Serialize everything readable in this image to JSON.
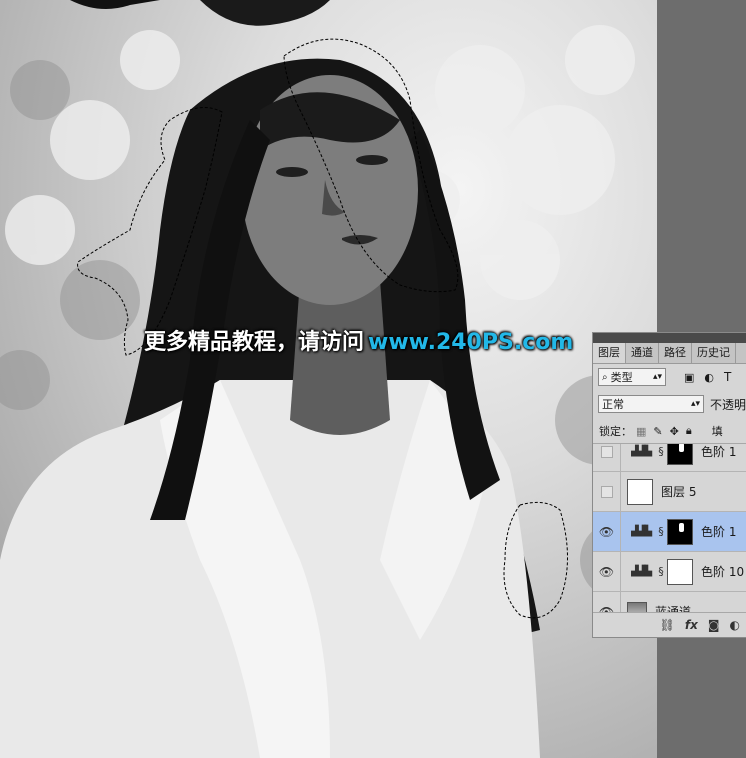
{
  "watermark": {
    "text_cn": "更多精品教程，请访问",
    "url": "www.240PS.com"
  },
  "panel": {
    "tabs": [
      "图层",
      "通道",
      "路径",
      "历史记"
    ],
    "filter": {
      "label": "类型",
      "icons": [
        "image-icon",
        "adjustment-icon",
        "text-icon"
      ],
      "text_icon_glyph": "T"
    },
    "blend_mode": "正常",
    "opacity_label": "不透明",
    "lock_label": "锁定：",
    "fill_label": "填",
    "layers": [
      {
        "name": "色阶 1",
        "visible": false,
        "type": "adjustment",
        "mask": "black"
      },
      {
        "name": "图层 5",
        "visible": false,
        "type": "pixel",
        "mask": "none"
      },
      {
        "name": "色阶 1",
        "visible": true,
        "type": "adjustment",
        "mask": "black",
        "selected": true
      },
      {
        "name": "色阶 10",
        "visible": true,
        "type": "adjustment",
        "mask": "white"
      },
      {
        "name": "蓝通道",
        "visible": true,
        "type": "pixel",
        "mask": "none"
      }
    ],
    "footer_icons": [
      "link-icon",
      "fx-icon",
      "mask-icon",
      "adjustment-icon"
    ],
    "footer_fx": "fx"
  },
  "colors": {
    "watermark_url": "#22b8e8",
    "selected_layer": "#a9c4ee",
    "panel_bg": "#d6d6d6"
  }
}
